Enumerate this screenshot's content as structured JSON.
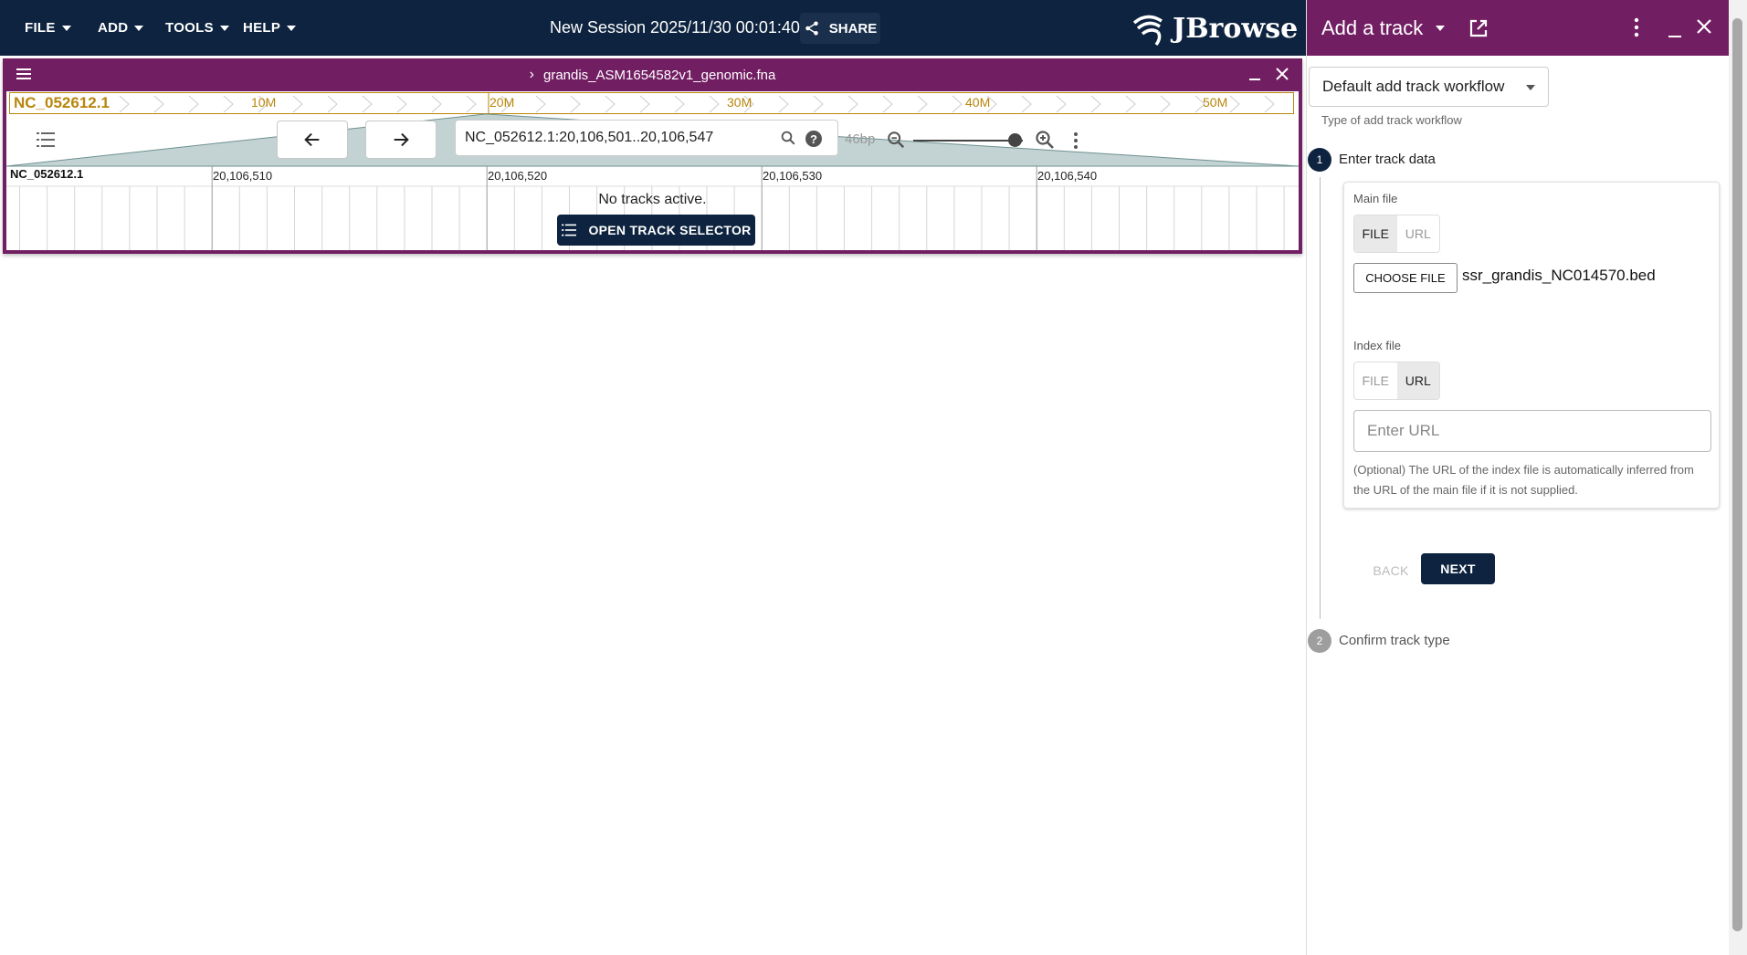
{
  "menubar": {
    "file": "FILE",
    "add": "ADD",
    "tools": "TOOLS",
    "help": "HELP",
    "session_title": "New Session 2025/11/30 00:01:40",
    "share": "SHARE",
    "logo": "JBrowse"
  },
  "view": {
    "title": "grandis_ASM1654582v1_genomic.fna",
    "overview_chr": "NC_052612.1",
    "overview_ticks": [
      "10M",
      "20M",
      "30M",
      "40M",
      "50M"
    ],
    "location": "NC_052612.1:20,106,501..20,106,547",
    "bp": "46bp",
    "zoom_level": 0.93,
    "ruler_chr": "NC_052612.1",
    "ruler_labels": [
      "20,106,510",
      "20,106,520",
      "20,106,530",
      "20,106,540"
    ],
    "no_tracks": "No tracks active.",
    "open_selector": "OPEN TRACK SELECTOR"
  },
  "drawer": {
    "title": "Add a track",
    "workflow_select": "Default add track workflow",
    "workflow_help": "Type of add track workflow",
    "step1": {
      "number": "1",
      "label": "Enter track data",
      "main_file_label": "Main file",
      "main_toggle": [
        "FILE",
        "URL"
      ],
      "choose_file": "CHOOSE FILE",
      "file_name": "ssr_grandis_NC014570.bed",
      "index_file_label": "Index file",
      "index_toggle": [
        "FILE",
        "URL"
      ],
      "url_placeholder": "Enter URL",
      "index_help": "(Optional) The URL of the index file is automatically inferred from the URL of the main file if it is not supplied."
    },
    "back": "BACK",
    "next": "NEXT",
    "step2": {
      "number": "2",
      "label": "Confirm track type"
    }
  },
  "colors": {
    "navy": "#0d233f",
    "purple": "#721e63",
    "gold": "#b8860b"
  }
}
